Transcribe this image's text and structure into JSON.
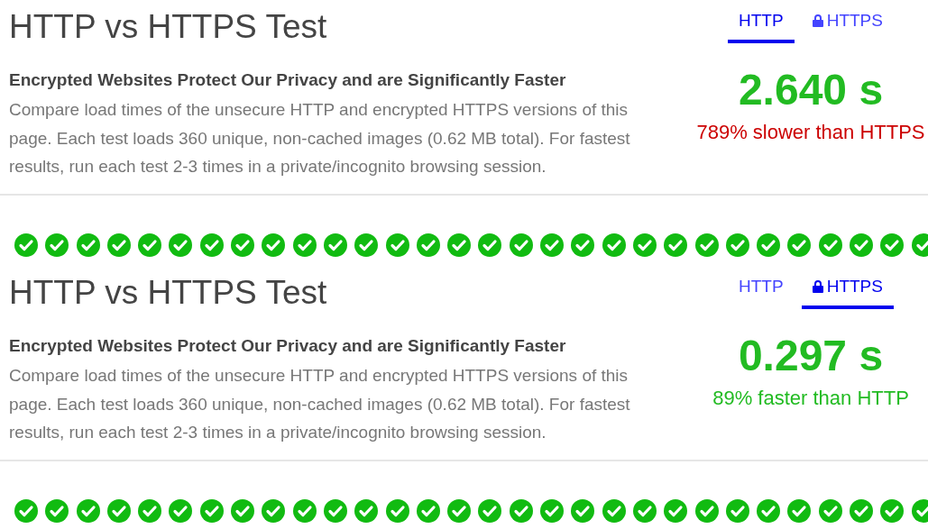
{
  "sections": [
    {
      "title": "HTTP vs HTTPS Test",
      "tabs": [
        {
          "label": "HTTP",
          "selected": true,
          "kind": "plain"
        },
        {
          "label": "HTTPS",
          "selected": false,
          "kind": "secure"
        }
      ],
      "heading": "Encrypted Websites Protect Our Privacy and are Significantly Faster",
      "description": "Compare load times of the unsecure HTTP and encrypted HTTPS versions of this page. Each test loads 360 unique, non-cached images (0.62 MB total). For fastest results, run each test 2-3 times in a private/incognito browsing session.",
      "result": {
        "time": "2.640 s",
        "comparison": "789% slower than HTTPS",
        "color": "#cc0000"
      }
    },
    {
      "title": "HTTP vs HTTPS Test",
      "tabs": [
        {
          "label": "HTTP",
          "selected": false,
          "kind": "plain"
        },
        {
          "label": "HTTPS",
          "selected": true,
          "kind": "secure"
        }
      ],
      "heading": "Encrypted Websites Protect Our Privacy and are Significantly Faster",
      "description": "Compare load times of the unsecure HTTP and encrypted HTTPS versions of this page. Each test loads 360 unique, non-cached images (0.62 MB total). For fastest results, run each test 2-3 times in a private/incognito browsing session.",
      "result": {
        "time": "0.297 s",
        "comparison": "89% faster than HTTP",
        "color": "#22bb22"
      }
    }
  ]
}
